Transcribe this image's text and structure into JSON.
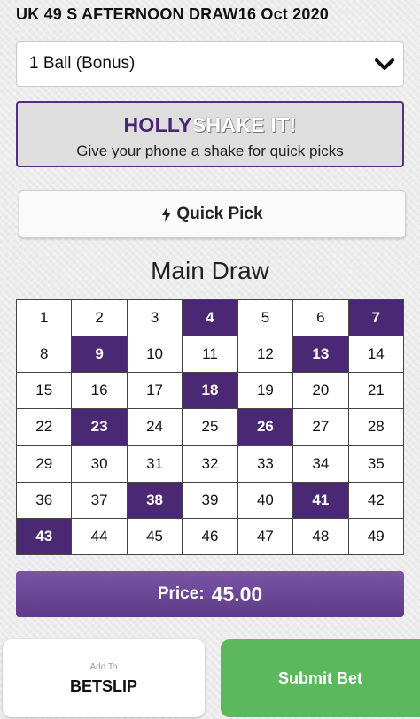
{
  "header": {
    "title": "UK 49 S AFTERNOON DRAW16 Oct 2020"
  },
  "bet_type": {
    "selected": "1 Ball (Bonus)"
  },
  "shake_banner": {
    "brand_part1": "HOLLY",
    "brand_part2": "SHAKE IT!",
    "subtitle": "Give your phone a shake for quick picks"
  },
  "quick_pick": {
    "label": "Quick Pick",
    "icon": "lightning-bolt-icon"
  },
  "main_draw": {
    "title": "Main Draw",
    "numbers": [
      "1",
      "2",
      "3",
      "4",
      "5",
      "6",
      "7",
      "8",
      "9",
      "10",
      "11",
      "12",
      "13",
      "14",
      "15",
      "16",
      "17",
      "18",
      "19",
      "20",
      "21",
      "22",
      "23",
      "24",
      "25",
      "26",
      "27",
      "28",
      "29",
      "30",
      "31",
      "32",
      "33",
      "34",
      "35",
      "36",
      "37",
      "38",
      "39",
      "40",
      "41",
      "42",
      "43",
      "44",
      "45",
      "46",
      "47",
      "48",
      "49"
    ],
    "selected": [
      4,
      7,
      9,
      13,
      18,
      23,
      26,
      38,
      41,
      43
    ]
  },
  "price": {
    "label": "Price:",
    "value": "45.00"
  },
  "footer": {
    "add_small": "Add To",
    "add_big": "BETSLIP",
    "submit": "Submit Bet"
  },
  "colors": {
    "accent_purple": "#4b2874",
    "submit_green": "#5cb85c",
    "price_purple": "#6f4a9a"
  }
}
